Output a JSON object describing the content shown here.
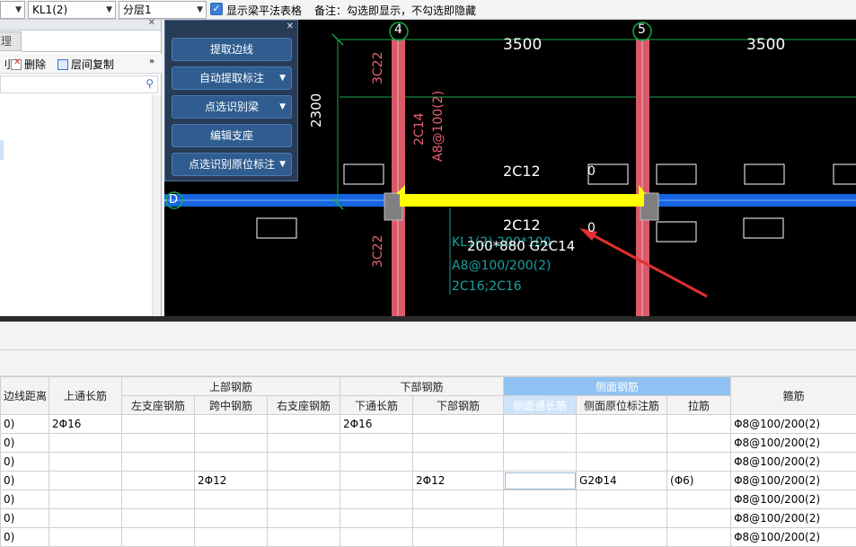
{
  "toolbar": {
    "beam_select": "KL1(2)",
    "floor_select": "分层1",
    "show_table_checked": true,
    "show_table_label": "显示梁平法表格",
    "remark": "备注：勾选即显示，不勾选即隐藏"
  },
  "left_panel": {
    "tab_label": "理",
    "delete_label": "删除",
    "copy_label": "层间复制"
  },
  "float_panel": {
    "buttons": [
      {
        "label": "提取边线",
        "has_dropdown": false
      },
      {
        "label": "自动提取标注",
        "has_dropdown": true
      },
      {
        "label": "点选识别梁",
        "has_dropdown": true
      },
      {
        "label": "编辑支座",
        "has_dropdown": false
      },
      {
        "label": "点选识别原位标注",
        "has_dropdown": true
      }
    ]
  },
  "canvas": {
    "axis_4": "4",
    "axis_5": "5",
    "axis_d": "D",
    "span_left": "3500",
    "span_right": "3500",
    "dim_vertical": "2300",
    "col_top_left": "3C22",
    "col_bottom_left": "3C22",
    "beam_vert_a": "2C14",
    "beam_vert_b": "A8@100(2)",
    "top_rebar": "2C12",
    "bottom_rebar": "2C12",
    "section_line": "200*880 G2C14",
    "kl_line1": "KL1(2) 200*100",
    "kl_line2": "A8@100/200(2)",
    "kl_line3": "2C16;2C16",
    "zero_top": "0",
    "zero_bottom": "0",
    "colors": {
      "beam": "#1565e0",
      "highlight": "#ffff00",
      "column": "#d85a6a",
      "dim": "#17a84a",
      "note": "#1aa0a0"
    }
  },
  "table": {
    "group_headers": {
      "edge_dist": "边线距离",
      "top_through": "上通长筋",
      "upper": "上部钢筋",
      "lower": "下部钢筋",
      "side": "侧面钢筋",
      "stirrup": "箍筋"
    },
    "sub_headers": {
      "left_support": "左支座钢筋",
      "mid_span": "跨中钢筋",
      "right_support": "右支座钢筋",
      "bottom_through": "下通长筋",
      "bottom_rebar": "下部钢筋",
      "side_through": "侧面通长筋",
      "side_orig": "侧面原位标注筋",
      "tie": "拉筋"
    },
    "rows": [
      {
        "edge": "0)",
        "top_through": "2Φ16",
        "left": "",
        "mid": "",
        "right": "",
        "bot_through": "2Φ16",
        "bot": "",
        "side_through": "",
        "side_orig": "",
        "tie": "",
        "stirrup": "Φ8@100/200(2)"
      },
      {
        "edge": "0)",
        "top_through": "",
        "left": "",
        "mid": "",
        "right": "",
        "bot_through": "",
        "bot": "",
        "side_through": "",
        "side_orig": "",
        "tie": "",
        "stirrup": "Φ8@100/200(2)"
      },
      {
        "edge": "0)",
        "top_through": "",
        "left": "",
        "mid": "",
        "right": "",
        "bot_through": "",
        "bot": "",
        "side_through": "",
        "side_orig": "",
        "tie": "",
        "stirrup": "Φ8@100/200(2)"
      },
      {
        "edge": "0)",
        "top_through": "",
        "left": "",
        "mid": "2Φ12",
        "right": "",
        "bot_through": "",
        "bot": "2Φ12",
        "side_through": "",
        "side_orig": "G2Φ14",
        "tie": "(Φ6)",
        "stirrup": "Φ8@100/200(2)"
      },
      {
        "edge": "0)",
        "top_through": "",
        "left": "",
        "mid": "",
        "right": "",
        "bot_through": "",
        "bot": "",
        "side_through": "",
        "side_orig": "",
        "tie": "",
        "stirrup": "Φ8@100/200(2)"
      },
      {
        "edge": "0)",
        "top_through": "",
        "left": "",
        "mid": "",
        "right": "",
        "bot_through": "",
        "bot": "",
        "side_through": "",
        "side_orig": "",
        "tie": "",
        "stirrup": "Φ8@100/200(2)"
      },
      {
        "edge": "0)",
        "top_through": "",
        "left": "",
        "mid": "",
        "right": "",
        "bot_through": "",
        "bot": "",
        "side_through": "",
        "side_orig": "",
        "tie": "",
        "stirrup": "Φ8@100/200(2)"
      }
    ]
  }
}
